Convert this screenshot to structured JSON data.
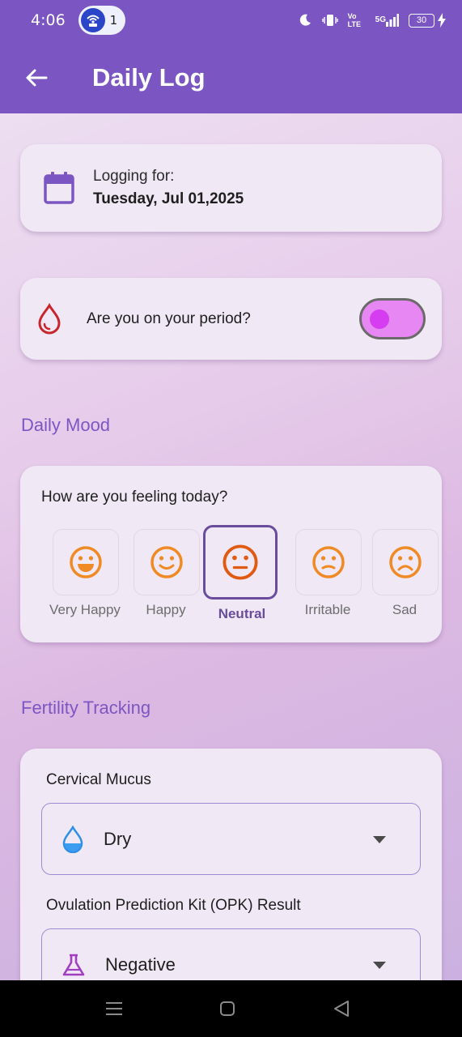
{
  "status_bar": {
    "time": "4:06",
    "hotspot_count": "1",
    "volte": "Vo LTE",
    "network": "5G",
    "battery": "30"
  },
  "appbar": {
    "title": "Daily Log"
  },
  "date_card": {
    "label": "Logging for:",
    "value": "Tuesday, Jul 01,2025"
  },
  "period_card": {
    "question": "Are you on your period?",
    "toggle_on": true
  },
  "mood_section": {
    "title": "Daily Mood",
    "question": "How are you feeling today?",
    "options": [
      {
        "label": "Very Happy",
        "icon": "very-happy-face-icon",
        "selected": false
      },
      {
        "label": "Happy",
        "icon": "happy-face-icon",
        "selected": false
      },
      {
        "label": "Neutral",
        "icon": "neutral-face-icon",
        "selected": true
      },
      {
        "label": "Irritable",
        "icon": "irritable-face-icon",
        "selected": false
      },
      {
        "label": "Sad",
        "icon": "sad-face-icon",
        "selected": false
      }
    ]
  },
  "fertility_section": {
    "title": "Fertility Tracking",
    "cervical_mucus": {
      "label": "Cervical Mucus",
      "value": "Dry",
      "icon": "water-drop-icon"
    },
    "opk": {
      "label": "Ovulation Prediction Kit (OPK) Result",
      "value": "Negative",
      "icon": "flask-icon"
    }
  },
  "colors": {
    "header": "#7b55c2",
    "accent": "#7d56c4",
    "toggle_track": "#e687f3",
    "toggle_knob": "#d63cf0",
    "mood_face": "#f08a24",
    "selected_border": "#6a4c9c"
  }
}
